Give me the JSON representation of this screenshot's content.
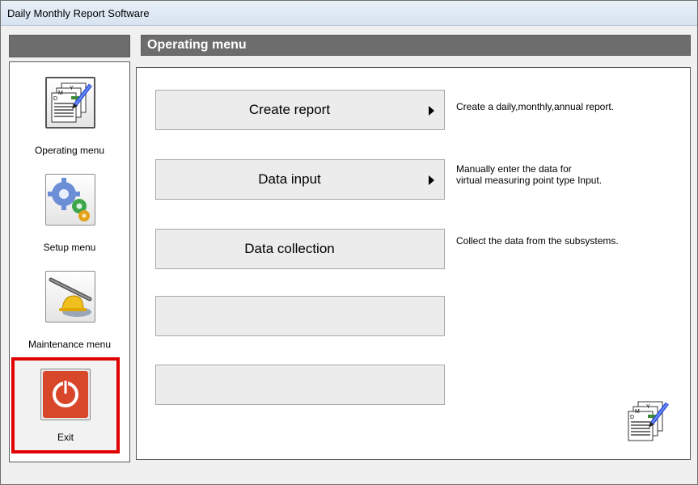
{
  "window": {
    "title": "Daily Monthly Report Software"
  },
  "header": {
    "section_title": "Operating menu"
  },
  "sidebar": {
    "items": [
      {
        "label": "Operating menu",
        "icon": "report-calendar-icon"
      },
      {
        "label": "Setup menu",
        "icon": "gears-icon"
      },
      {
        "label": "Maintenance menu",
        "icon": "tools-helmet-icon"
      },
      {
        "label": "Exit",
        "icon": "power-icon"
      }
    ]
  },
  "main": {
    "buttons": [
      {
        "label": "Create report",
        "has_arrow": true,
        "description_line1": "Create a daily,monthly,annual report.",
        "description_line2": ""
      },
      {
        "label": "Data input",
        "has_arrow": true,
        "description_line1": "Manually enter the data for",
        "description_line2": "virtual measuring point type Input."
      },
      {
        "label": "Data collection",
        "has_arrow": false,
        "description_line1": "Collect the data from the subsystems.",
        "description_line2": ""
      },
      {
        "label": "",
        "has_arrow": false,
        "description_line1": "",
        "description_line2": ""
      },
      {
        "label": "",
        "has_arrow": false,
        "description_line1": "",
        "description_line2": ""
      }
    ],
    "corner_icon": "report-calendar-icon"
  },
  "colors": {
    "header_bar": "#6d6d6d",
    "highlight": "#e00000",
    "exit_icon": "#d9472b"
  }
}
